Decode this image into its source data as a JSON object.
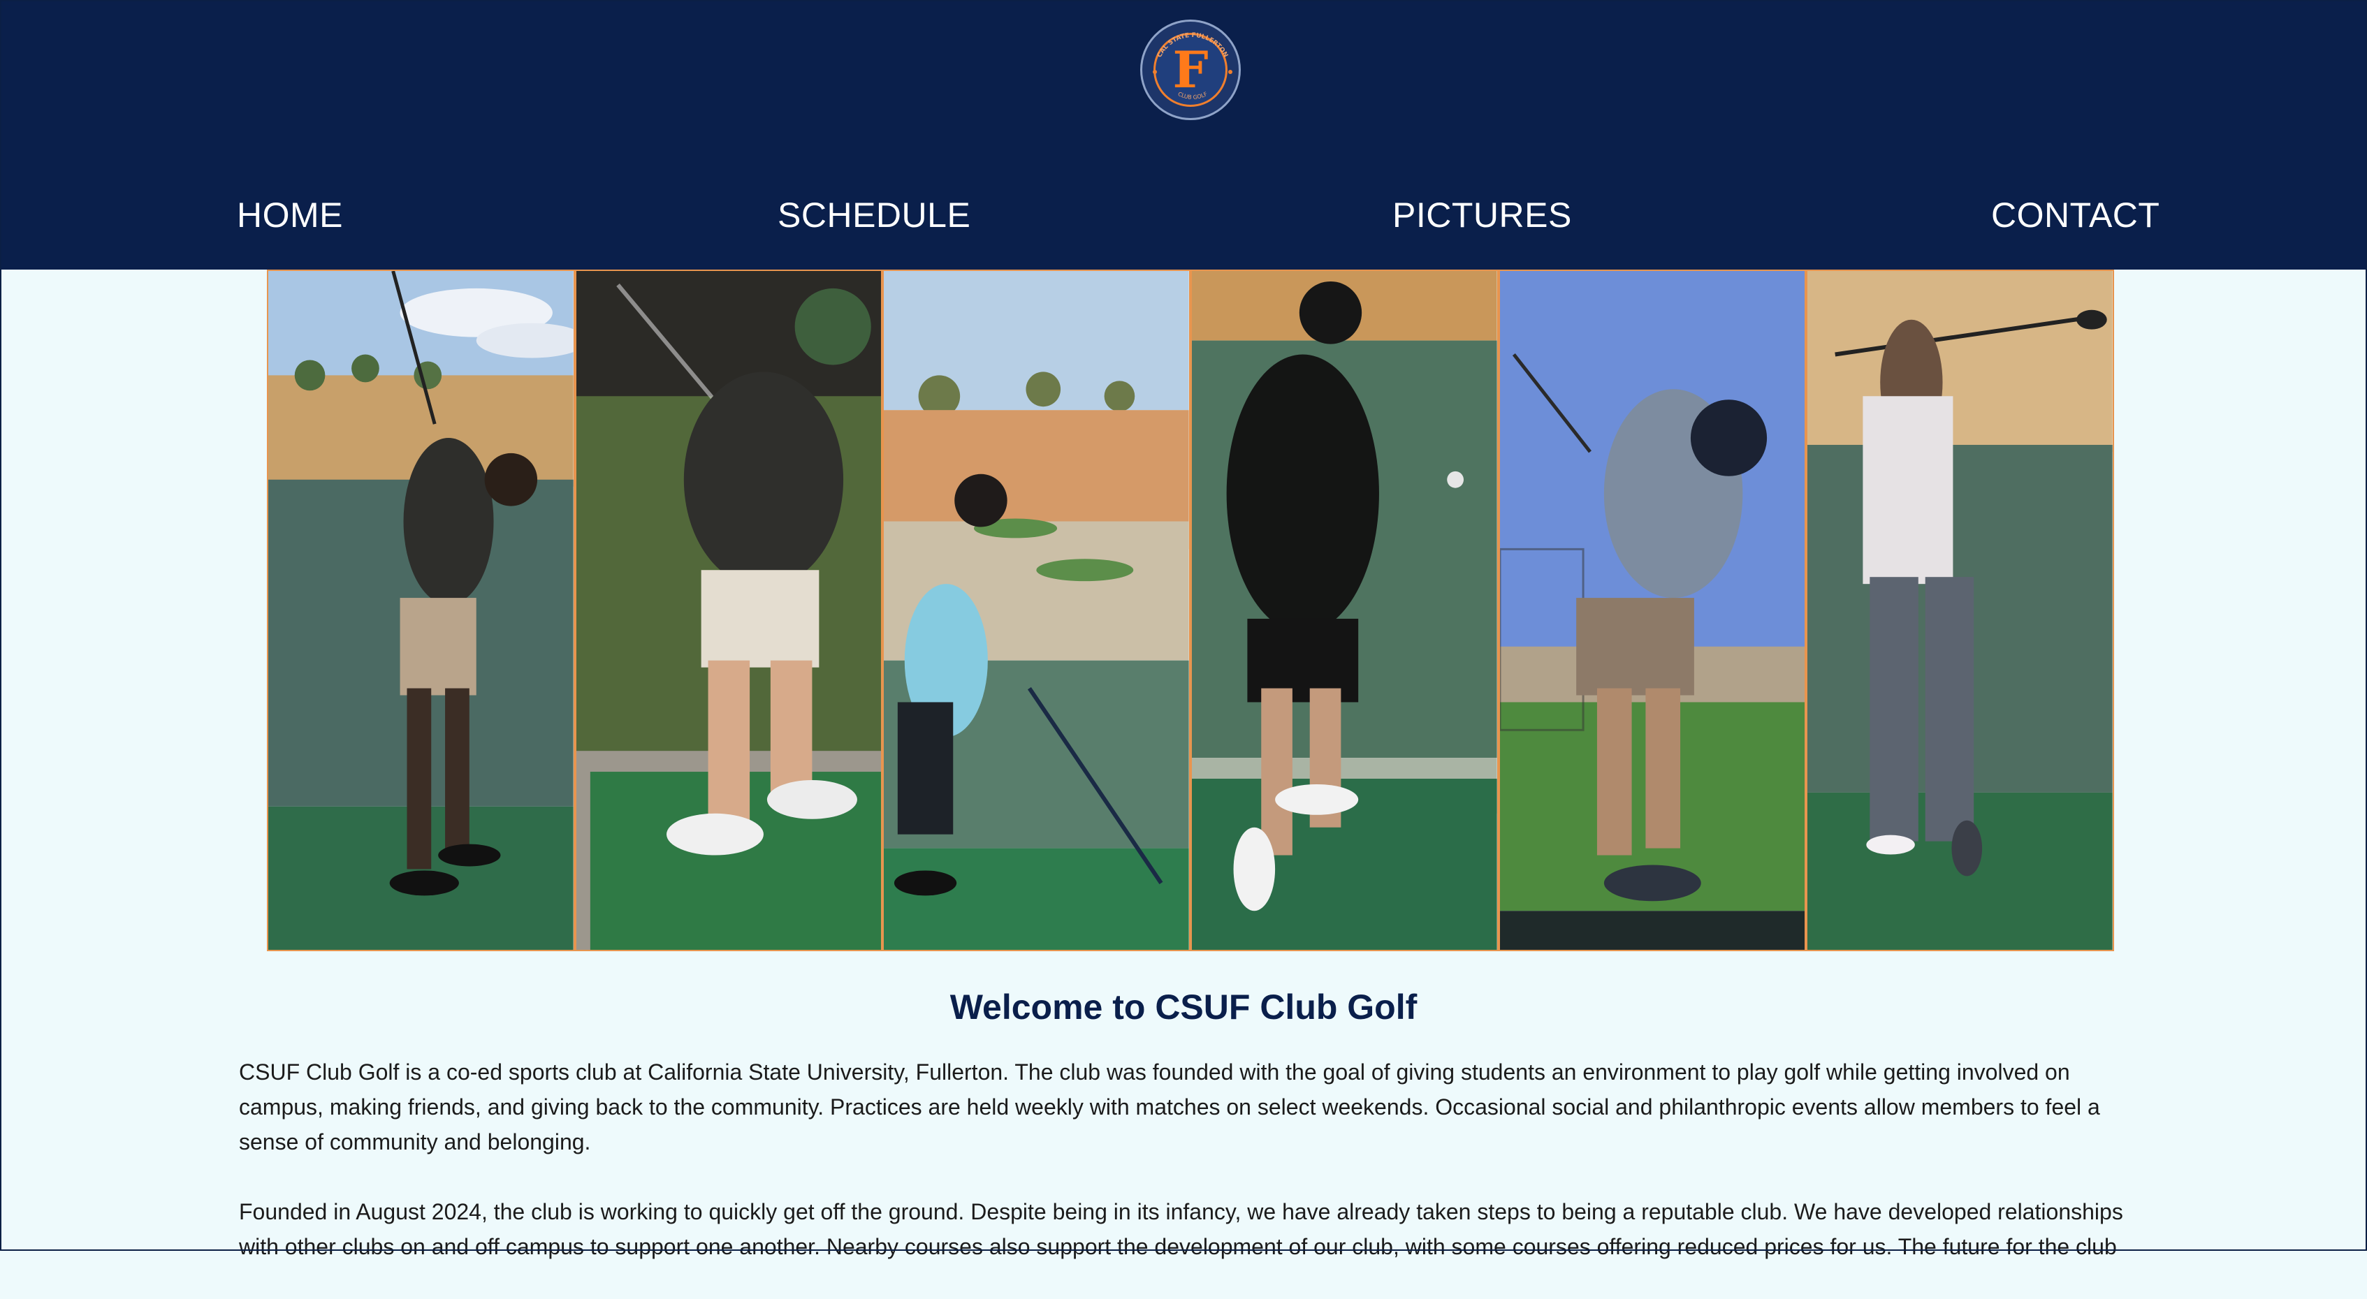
{
  "header": {
    "logo": {
      "letter": "F",
      "ring_text_top": "CAL STATE FULLERTON",
      "ring_text_bottom": "CLUB GOLF"
    },
    "nav": [
      {
        "label": "HOME"
      },
      {
        "label": "SCHEDULE"
      },
      {
        "label": "PICTURES"
      },
      {
        "label": "CONTACT"
      }
    ]
  },
  "gallery": {
    "photos": [
      {
        "description": "golfer-backswing-driving-range"
      },
      {
        "description": "golfer-green-cap-night-range"
      },
      {
        "description": "golfer-blue-shirt-address"
      },
      {
        "description": "golfer-black-dress-followthrough"
      },
      {
        "description": "golfer-grey-shirt-followthrough"
      },
      {
        "description": "golfer-white-shirt-finish"
      }
    ]
  },
  "main": {
    "title": "Welcome to CSUF Club Golf",
    "paragraphs": [
      "CSUF Club Golf is a co-ed sports club at California State University, Fullerton. The club was founded with the goal of giving students an environment to play golf while getting involved on campus, making friends, and giving back to the community. Practices are held weekly with matches on select weekends. Occasional social and philanthropic events allow members to feel a sense of community and belonging.",
      "Founded in August 2024, the club is working to quickly get off the ground. Despite being in its infancy, we have already taken steps to being a reputable club. We have developed relationships with other clubs on and off campus to support one another. Nearby courses also support the development of our club, with some courses offering reduced prices for us. The future for the club"
    ]
  },
  "colors": {
    "header_bg": "#0a1f4b",
    "page_bg": "#eefafc",
    "accent_orange": "#f07f2d",
    "title_color": "#0a1f4b"
  }
}
